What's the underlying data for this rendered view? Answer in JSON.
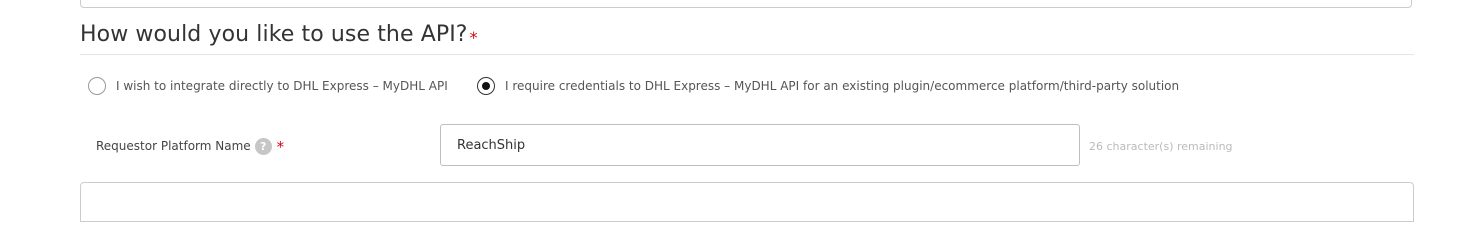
{
  "section": {
    "heading": "How would you like to use the API?",
    "required_mark": "*"
  },
  "usage_options": [
    {
      "label": "I wish to integrate directly to DHL Express – MyDHL API",
      "selected": false
    },
    {
      "label": "I require credentials to DHL Express – MyDHL API for an existing plugin/ecommerce platform/third-party solution",
      "selected": true
    }
  ],
  "requestor_field": {
    "label": "Requestor Platform Name",
    "help_icon": "?",
    "required_mark": "*",
    "value": "ReachShip",
    "remaining_text": "26 character(s) remaining"
  },
  "colors": {
    "required": "#d40511",
    "border": "#cccccc",
    "muted_text": "#bbbbbb"
  }
}
